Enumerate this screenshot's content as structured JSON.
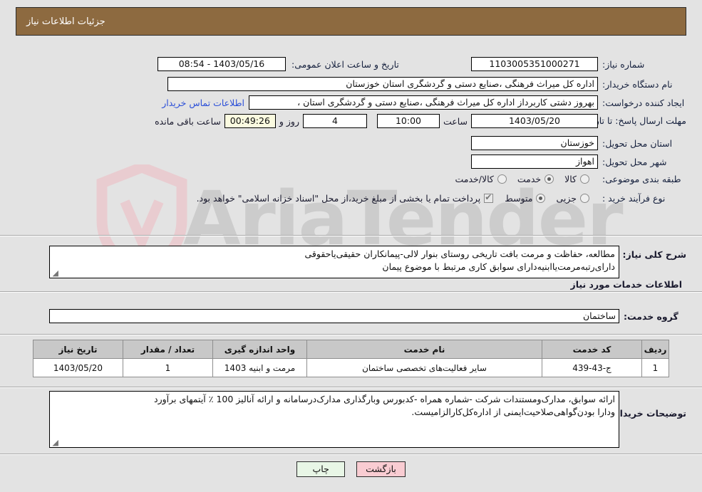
{
  "header": {
    "title": "جزئیات اطلاعات نیاز",
    "bg_color": "#8d6a40",
    "text_color": "#ffffff"
  },
  "watermark": {
    "text": "AriaTender",
    "shield_color": "#e5c8cc",
    "text_color": "#c9c9c9"
  },
  "form": {
    "need_number_label": "شماره نیاز:",
    "need_number_value": "1103005351000271",
    "announce_datetime_label": "تاریخ و ساعت اعلان عمومی:",
    "announce_datetime_value": "1403/05/16 - 08:54",
    "buyer_org_label": "نام دستگاه خریدار:",
    "buyer_org_value": "اداره کل میراث فرهنگی ،صنایع دستی و گردشگری استان خوزستان",
    "requester_label": "ایجاد کننده درخواست:",
    "requester_value": "بهروز دشتی کاربرداز اداره کل میراث فرهنگی ،صنایع دستی و گردشگری استان ،",
    "buyer_contact_link": "اطلاعات تماس خریدار",
    "deadline_label": "مهلت ارسال پاسخ: تا تاریخ:",
    "deadline_date": "1403/05/20",
    "deadline_hour_label": "ساعت",
    "deadline_hour": "10:00",
    "remaining_days": "4",
    "remaining_days_suffix": "روز و",
    "remaining_time": "00:49:26",
    "remaining_suffix": "ساعت باقی مانده",
    "province_label": "استان محل تحویل:",
    "province_value": "خوزستان",
    "city_label": "شهر محل تحویل:",
    "city_value": "اهواز",
    "category_label": "طبقه بندی موضوعی:",
    "category_options": [
      {
        "label": "کالا",
        "selected": false
      },
      {
        "label": "خدمت",
        "selected": true
      },
      {
        "label": "کالا/خدمت",
        "selected": false
      }
    ],
    "process_label": "نوع فرآیند خرید :",
    "process_options": [
      {
        "label": "جزیی",
        "selected": false
      },
      {
        "label": "متوسط",
        "selected": true
      }
    ],
    "treasury_checkbox_checked": true,
    "treasury_text": "پرداخت تمام یا بخشی از مبلغ خرید،از محل \"اسناد خزانه اسلامی\" خواهد بود."
  },
  "description": {
    "label": "شرح کلی نیاز:",
    "line1": "مطالعه، حفاظت و مرمت بافت تاریخی روستای بنوار لالی-پیمانکاران حقیقی‌یاحقوقی",
    "line2": "دارای‌رتبه‌مرمت‌یاابنیه‌دارای سوابق کاری مرتبط با موضوع پیمان"
  },
  "services_section": {
    "heading": "اطلاعات خدمات مورد نیاز",
    "service_group_label": "گروه خدمت:",
    "service_group_value": "ساختمان"
  },
  "table": {
    "columns": [
      "ردیف",
      "کد خدمت",
      "نام خدمت",
      "واحد اندازه گیری",
      "تعداد / مقدار",
      "تاریخ نیاز"
    ],
    "rows": [
      {
        "index": "1",
        "service_code": "ج-43-439",
        "service_name": "سایر فعالیت‌های تخصصی ساختمان",
        "unit": "مرمت و ابنیه 1403",
        "quantity": "1",
        "need_date": "1403/05/20"
      }
    ]
  },
  "buyer_notes": {
    "label": "توضیحات خریدار:",
    "line1": "ارائه سوابق، مدارک‌ومستندات شرکت -شماره همراه -کدبورس وبارگذاری مدارک‌درسامانه و ارائه آنالیز 100 ٪ آیتمهای برآورد",
    "line2": "ودارا بودن‌گواهی‌صلاحیت‌ایمنی از اداره‌کل‌کارالزامیست."
  },
  "buttons": {
    "print": "چاپ",
    "back": "بازگشت"
  }
}
